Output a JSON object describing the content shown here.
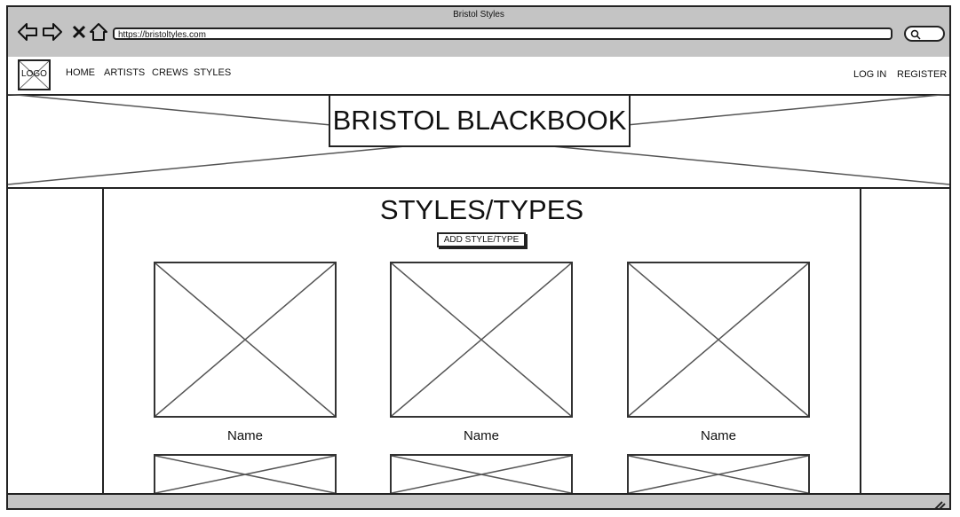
{
  "window": {
    "title": "Bristol Styles"
  },
  "browser": {
    "url": "https://bristoltyles.com",
    "nav_icons": [
      "back-arrow-icon",
      "forward-arrow-icon",
      "close-icon",
      "home-icon"
    ],
    "search_icon": "search-icon"
  },
  "navbar": {
    "logo_label": "LOGO",
    "links": [
      "HOME",
      "ARTISTS",
      "CREWS",
      "STYLES"
    ],
    "login_label": "LOG IN",
    "register_label": "REGISTER"
  },
  "hero": {
    "title": "BRISTOL BLACKBOOK"
  },
  "main": {
    "title": "STYLES/TYPES",
    "add_button_label": "ADD STYLE/TYPE",
    "cards": [
      {
        "name": "Name"
      },
      {
        "name": "Name"
      },
      {
        "name": "Name"
      }
    ],
    "second_row_count": 3
  },
  "colors": {
    "chrome": "#c4c4c4",
    "line": "#222222"
  }
}
